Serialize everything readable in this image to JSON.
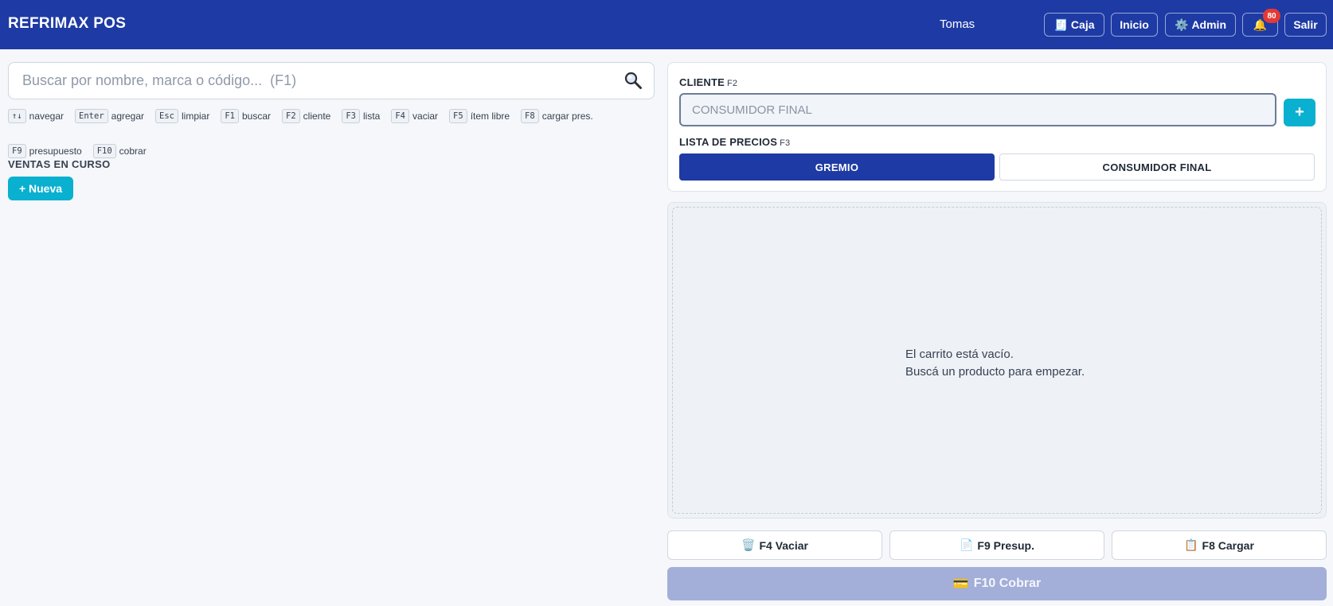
{
  "header": {
    "brand": "REFRIMAX POS",
    "user": "Tomas",
    "buttons": {
      "caja": {
        "icon": "🧾",
        "label": "Caja"
      },
      "inicio": {
        "label": "Inicio"
      },
      "admin": {
        "icon": "⚙️",
        "label": "Admin"
      },
      "notifications": {
        "icon": "🔔",
        "count": "80"
      },
      "salir": {
        "label": "Salir"
      }
    }
  },
  "search": {
    "placeholder": "Buscar por nombre, marca o código...  (F1)",
    "icon": "🔍"
  },
  "shortcuts": [
    {
      "key": "↑↓",
      "label": "navegar"
    },
    {
      "key": "Enter",
      "label": "agregar"
    },
    {
      "key": "Esc",
      "label": "limpiar"
    },
    {
      "key": "F1",
      "label": "buscar"
    },
    {
      "key": "F2",
      "label": "cliente"
    },
    {
      "key": "F3",
      "label": "lista"
    },
    {
      "key": "F4",
      "label": "vaciar"
    },
    {
      "key": "F5",
      "label": "ítem libre"
    },
    {
      "key": "F8",
      "label": "cargar pres."
    },
    {
      "key": "F9",
      "label": "presupuesto"
    },
    {
      "key": "F10",
      "label": "cobrar"
    }
  ],
  "sales": {
    "title": "VENTAS EN CURSO",
    "new_label": "+ Nueva"
  },
  "client": {
    "label": "CLIENTE",
    "key": "F2",
    "placeholder": "CONSUMIDOR FINAL",
    "add_label": "+"
  },
  "price_list": {
    "label": "LISTA DE PRECIOS",
    "key": "F3",
    "options": [
      "GREMIO",
      "CONSUMIDOR FINAL"
    ],
    "selected": "GREMIO"
  },
  "cart": {
    "empty_line1": "El carrito está vacío.",
    "empty_line2": "Buscá un producto para empezar."
  },
  "actions": {
    "vaciar": {
      "icon": "🗑️",
      "label": "F4 Vaciar"
    },
    "presup": {
      "icon": "📄",
      "label": "F9 Presup."
    },
    "cargar": {
      "icon": "📋",
      "label": "F8 Cargar"
    },
    "cobrar": {
      "icon": "💳",
      "label": "F10 Cobrar"
    }
  },
  "colors": {
    "header_bg": "#1e3aa4",
    "accent": "#0ab0cf",
    "badge": "#e53935",
    "charge_disabled": "#a3aed9"
  }
}
